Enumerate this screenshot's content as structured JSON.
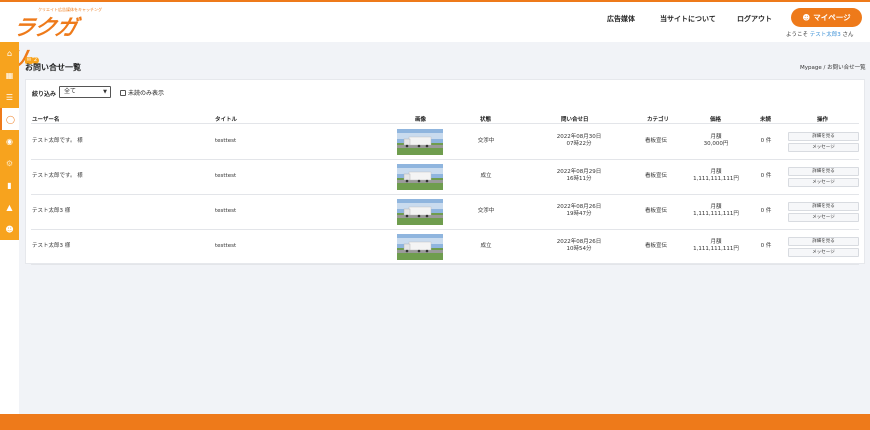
{
  "header": {
    "logo_tagline": "クリエイト広告媒体をキャッチング",
    "logo_text": "ラクガリ",
    "nav": [
      "広告媒体",
      "当サイトについて",
      "ログアウト"
    ],
    "mypage_label": "マイページ",
    "welcome_prefix": "ようこそ ",
    "welcome_user": "テスト太郎3",
    "welcome_suffix": " さん"
  },
  "notifications": {
    "count": "2"
  },
  "page": {
    "title": "お問い合せ一覧",
    "breadcrumb": "Mypage / お問い合せ一覧"
  },
  "filter": {
    "label": "絞り込み",
    "selected": "全て",
    "unread_only_label": "未読のみ表示"
  },
  "table": {
    "headers": [
      "ユーザー名",
      "タイトル",
      "画像",
      "状態",
      "問い合せ日",
      "カテゴリ",
      "価格",
      "未読",
      "操作"
    ],
    "rows": [
      {
        "user": "テスト太郎です。 様",
        "title": "testtest",
        "status": "交渉中",
        "date1": "2022年08月30日",
        "date2": "07時22分",
        "category": "看板宣伝",
        "price1": "月額",
        "price2": "30,000円",
        "unread": "0 件"
      },
      {
        "user": "テスト太郎です。 様",
        "title": "testtest",
        "status": "成立",
        "date1": "2022年08月29日",
        "date2": "16時11分",
        "category": "看板宣伝",
        "price1": "月額",
        "price2": "1,111,111,111円",
        "unread": "0 件"
      },
      {
        "user": "テスト太郎3 様",
        "title": "testtest",
        "status": "交渉中",
        "date1": "2022年08月26日",
        "date2": "19時47分",
        "category": "看板宣伝",
        "price1": "月額",
        "price2": "1,111,111,111円",
        "unread": "0 件"
      },
      {
        "user": "テスト太郎3 様",
        "title": "testtest",
        "status": "成立",
        "date1": "2022年08月26日",
        "date2": "10時54分",
        "category": "看板宣伝",
        "price1": "月額",
        "price2": "1,111,111,111円",
        "unread": "0 件"
      }
    ],
    "detail_label": "詳細を見る",
    "message_label": "メッセージ"
  },
  "colors": {
    "brand": "#ee7a1a",
    "sidebar": "#f7a31e",
    "link": "#3a8fd6"
  },
  "sidebar_icons": [
    "home-icon",
    "grid-icon",
    "list-icon",
    "chat-icon",
    "comment-icon",
    "settings-icon",
    "bookmark-icon",
    "fire-icon",
    "user-icon"
  ]
}
